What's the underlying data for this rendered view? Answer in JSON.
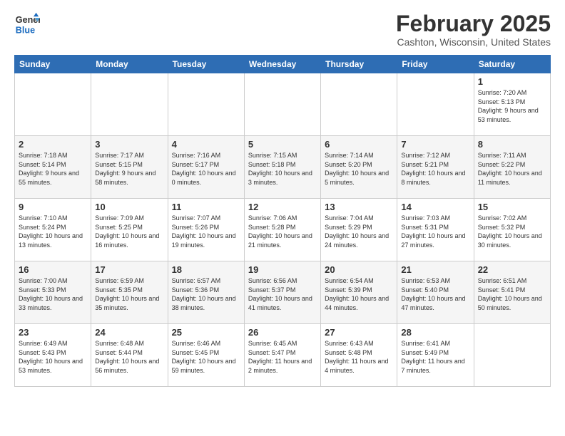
{
  "header": {
    "logo_line1": "General",
    "logo_line2": "Blue",
    "month": "February 2025",
    "location": "Cashton, Wisconsin, United States"
  },
  "weekdays": [
    "Sunday",
    "Monday",
    "Tuesday",
    "Wednesday",
    "Thursday",
    "Friday",
    "Saturday"
  ],
  "weeks": [
    [
      {
        "day": "",
        "detail": ""
      },
      {
        "day": "",
        "detail": ""
      },
      {
        "day": "",
        "detail": ""
      },
      {
        "day": "",
        "detail": ""
      },
      {
        "day": "",
        "detail": ""
      },
      {
        "day": "",
        "detail": ""
      },
      {
        "day": "1",
        "detail": "Sunrise: 7:20 AM\nSunset: 5:13 PM\nDaylight: 9 hours\nand 53 minutes."
      }
    ],
    [
      {
        "day": "2",
        "detail": "Sunrise: 7:18 AM\nSunset: 5:14 PM\nDaylight: 9 hours\nand 55 minutes."
      },
      {
        "day": "3",
        "detail": "Sunrise: 7:17 AM\nSunset: 5:15 PM\nDaylight: 9 hours\nand 58 minutes."
      },
      {
        "day": "4",
        "detail": "Sunrise: 7:16 AM\nSunset: 5:17 PM\nDaylight: 10 hours\nand 0 minutes."
      },
      {
        "day": "5",
        "detail": "Sunrise: 7:15 AM\nSunset: 5:18 PM\nDaylight: 10 hours\nand 3 minutes."
      },
      {
        "day": "6",
        "detail": "Sunrise: 7:14 AM\nSunset: 5:20 PM\nDaylight: 10 hours\nand 5 minutes."
      },
      {
        "day": "7",
        "detail": "Sunrise: 7:12 AM\nSunset: 5:21 PM\nDaylight: 10 hours\nand 8 minutes."
      },
      {
        "day": "8",
        "detail": "Sunrise: 7:11 AM\nSunset: 5:22 PM\nDaylight: 10 hours\nand 11 minutes."
      }
    ],
    [
      {
        "day": "9",
        "detail": "Sunrise: 7:10 AM\nSunset: 5:24 PM\nDaylight: 10 hours\nand 13 minutes."
      },
      {
        "day": "10",
        "detail": "Sunrise: 7:09 AM\nSunset: 5:25 PM\nDaylight: 10 hours\nand 16 minutes."
      },
      {
        "day": "11",
        "detail": "Sunrise: 7:07 AM\nSunset: 5:26 PM\nDaylight: 10 hours\nand 19 minutes."
      },
      {
        "day": "12",
        "detail": "Sunrise: 7:06 AM\nSunset: 5:28 PM\nDaylight: 10 hours\nand 21 minutes."
      },
      {
        "day": "13",
        "detail": "Sunrise: 7:04 AM\nSunset: 5:29 PM\nDaylight: 10 hours\nand 24 minutes."
      },
      {
        "day": "14",
        "detail": "Sunrise: 7:03 AM\nSunset: 5:31 PM\nDaylight: 10 hours\nand 27 minutes."
      },
      {
        "day": "15",
        "detail": "Sunrise: 7:02 AM\nSunset: 5:32 PM\nDaylight: 10 hours\nand 30 minutes."
      }
    ],
    [
      {
        "day": "16",
        "detail": "Sunrise: 7:00 AM\nSunset: 5:33 PM\nDaylight: 10 hours\nand 33 minutes."
      },
      {
        "day": "17",
        "detail": "Sunrise: 6:59 AM\nSunset: 5:35 PM\nDaylight: 10 hours\nand 35 minutes."
      },
      {
        "day": "18",
        "detail": "Sunrise: 6:57 AM\nSunset: 5:36 PM\nDaylight: 10 hours\nand 38 minutes."
      },
      {
        "day": "19",
        "detail": "Sunrise: 6:56 AM\nSunset: 5:37 PM\nDaylight: 10 hours\nand 41 minutes."
      },
      {
        "day": "20",
        "detail": "Sunrise: 6:54 AM\nSunset: 5:39 PM\nDaylight: 10 hours\nand 44 minutes."
      },
      {
        "day": "21",
        "detail": "Sunrise: 6:53 AM\nSunset: 5:40 PM\nDaylight: 10 hours\nand 47 minutes."
      },
      {
        "day": "22",
        "detail": "Sunrise: 6:51 AM\nSunset: 5:41 PM\nDaylight: 10 hours\nand 50 minutes."
      }
    ],
    [
      {
        "day": "23",
        "detail": "Sunrise: 6:49 AM\nSunset: 5:43 PM\nDaylight: 10 hours\nand 53 minutes."
      },
      {
        "day": "24",
        "detail": "Sunrise: 6:48 AM\nSunset: 5:44 PM\nDaylight: 10 hours\nand 56 minutes."
      },
      {
        "day": "25",
        "detail": "Sunrise: 6:46 AM\nSunset: 5:45 PM\nDaylight: 10 hours\nand 59 minutes."
      },
      {
        "day": "26",
        "detail": "Sunrise: 6:45 AM\nSunset: 5:47 PM\nDaylight: 11 hours\nand 2 minutes."
      },
      {
        "day": "27",
        "detail": "Sunrise: 6:43 AM\nSunset: 5:48 PM\nDaylight: 11 hours\nand 4 minutes."
      },
      {
        "day": "28",
        "detail": "Sunrise: 6:41 AM\nSunset: 5:49 PM\nDaylight: 11 hours\nand 7 minutes."
      },
      {
        "day": "",
        "detail": ""
      }
    ]
  ]
}
